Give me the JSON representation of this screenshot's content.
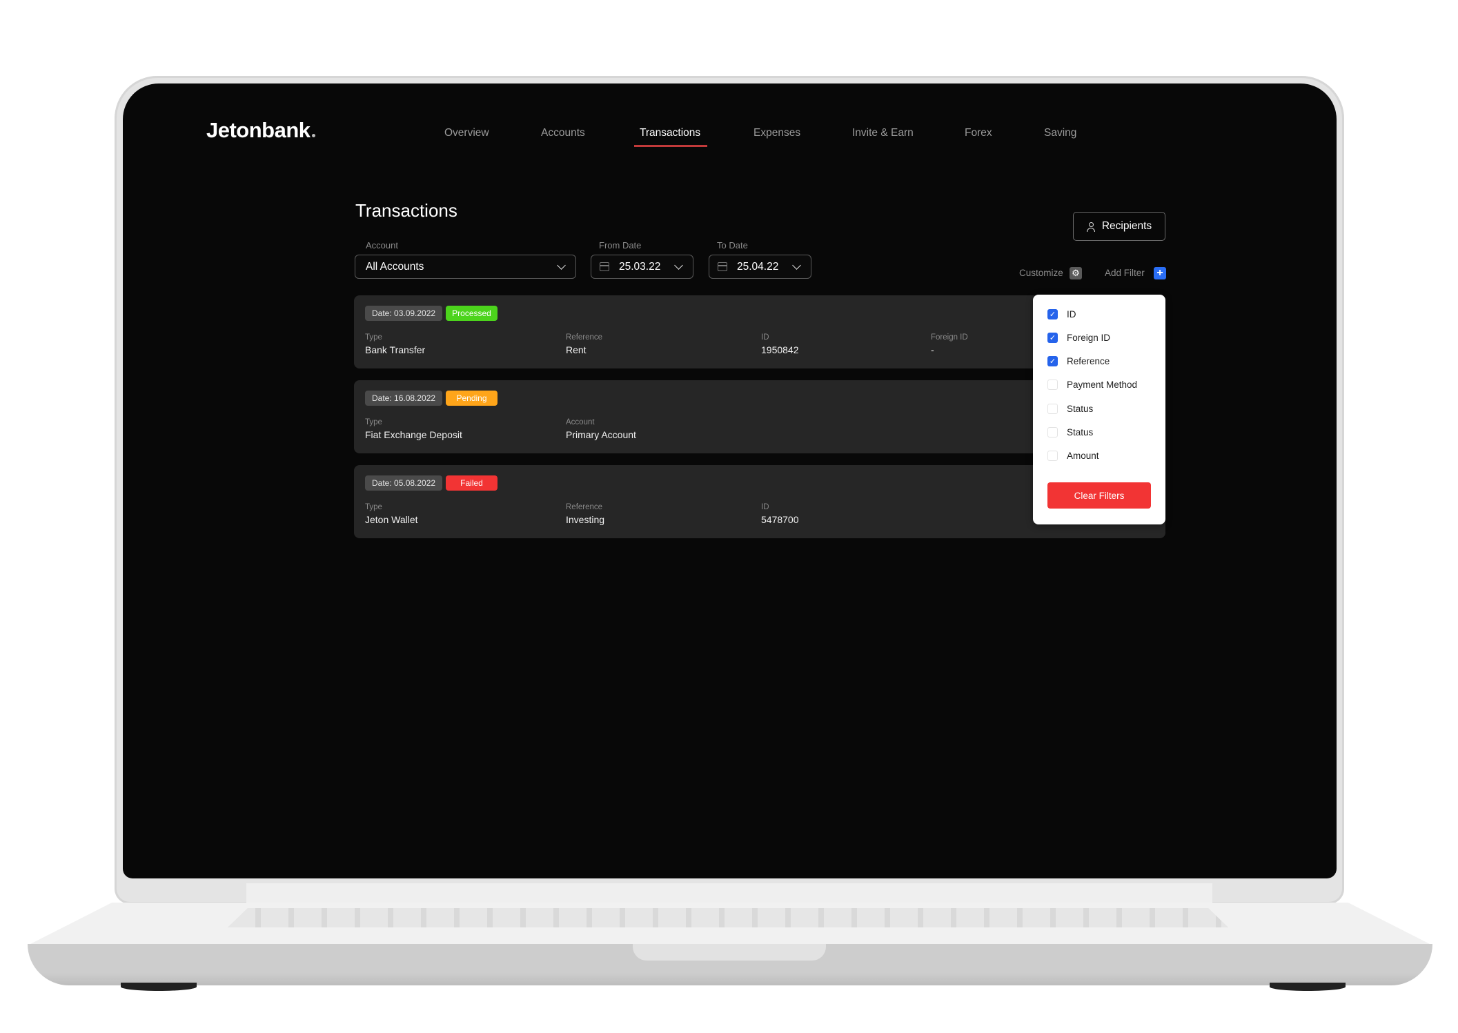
{
  "app": {
    "brand": "Jetonbank"
  },
  "nav": {
    "items": [
      {
        "label": "Overview",
        "active": false
      },
      {
        "label": "Accounts",
        "active": false
      },
      {
        "label": "Transactions",
        "active": true
      },
      {
        "label": "Expenses",
        "active": false
      },
      {
        "label": "Invite & Earn",
        "active": false
      },
      {
        "label": "Forex",
        "active": false
      },
      {
        "label": "Saving",
        "active": false
      }
    ],
    "active_underline_color": "#c23a3a"
  },
  "page": {
    "title": "Transactions"
  },
  "filters": {
    "account": {
      "label": "Account",
      "value": "All Accounts"
    },
    "from_date": {
      "label": "From Date",
      "value": "25.03.22"
    },
    "to_date": {
      "label": "To Date",
      "value": "25.04.22"
    }
  },
  "toolbar": {
    "recipients_label": "Recipients",
    "customize_label": "Customize",
    "add_filter_label": "Add Filter",
    "gear_icon": "⚙",
    "plus_icon": "+"
  },
  "transactions": [
    {
      "date": "Date: 03.09.2022",
      "status": "Processed",
      "status_color": "#4cd41c",
      "fields": [
        {
          "label": "Type",
          "value": "Bank Transfer"
        },
        {
          "label": "Reference",
          "value": "Rent"
        },
        {
          "label": "ID",
          "value": "1950842"
        },
        {
          "label": "Foreign ID",
          "value": "-"
        }
      ]
    },
    {
      "date": "Date: 16.08.2022",
      "status": "Pending",
      "status_color": "#ffa51a",
      "fields": [
        {
          "label": "Type",
          "value": "Fiat Exchange Deposit"
        },
        {
          "label": "Account",
          "value": "Primary Account"
        }
      ]
    },
    {
      "date": "Date: 05.08.2022",
      "status": "Failed",
      "status_color": "#f23434",
      "fields": [
        {
          "label": "Type",
          "value": "Jeton Wallet"
        },
        {
          "label": "Reference",
          "value": "Investing"
        },
        {
          "label": "ID",
          "value": "5478700"
        }
      ]
    }
  ],
  "customize_popup": {
    "options": [
      {
        "label": "ID",
        "checked": true
      },
      {
        "label": "Foreign ID",
        "checked": true
      },
      {
        "label": "Reference",
        "checked": true
      },
      {
        "label": "Payment Method",
        "checked": false
      },
      {
        "label": "Status",
        "checked": false
      },
      {
        "label": "Status",
        "checked": false
      },
      {
        "label": "Amount",
        "checked": false
      }
    ],
    "clear_label": "Clear Filters",
    "check_glyph": "✓"
  }
}
